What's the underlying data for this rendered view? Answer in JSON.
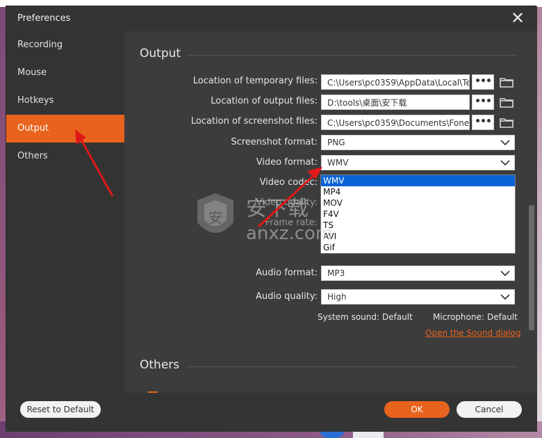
{
  "window": {
    "title": "Preferences"
  },
  "sidebar": {
    "items": [
      {
        "label": "Recording",
        "active": false
      },
      {
        "label": "Mouse",
        "active": false
      },
      {
        "label": "Hotkeys",
        "active": false
      },
      {
        "label": "Output",
        "active": true
      },
      {
        "label": "Others",
        "active": false
      }
    ]
  },
  "output": {
    "heading": "Output",
    "temp_files": {
      "label": "Location of temporary files:",
      "value": "C:\\Users\\pc0359\\AppData\\Local\\Te"
    },
    "output_files": {
      "label": "Location of output files:",
      "value": "D:\\tools\\桌面\\安下载"
    },
    "screenshot_files": {
      "label": "Location of screenshot files:",
      "value": "C:\\Users\\pc0359\\Documents\\FoneI"
    },
    "screenshot_format": {
      "label": "Screenshot format:",
      "value": "PNG"
    },
    "video_format": {
      "label": "Video format:",
      "value": "WMV",
      "options": [
        "WMV",
        "MP4",
        "MOV",
        "F4V",
        "TS",
        "AVI",
        "Gif"
      ],
      "selected_index": 0
    },
    "video_codec": {
      "label": "Video codec:"
    },
    "video_quality": {
      "label": "Video quality:"
    },
    "frame_rate": {
      "label": "Frame rate:"
    },
    "audio_format": {
      "label": "Audio format:",
      "value": "MP3"
    },
    "audio_quality": {
      "label": "Audio quality:",
      "value": "High"
    },
    "system_sound": {
      "label": "System sound:",
      "value": "Default"
    },
    "microphone": {
      "label": "Microphone:",
      "value": "Default"
    },
    "sound_dialog_link": "Open the Sound dialog"
  },
  "others": {
    "heading": "Others"
  },
  "footer": {
    "reset_label": "Reset to Default",
    "ok_label": "OK",
    "cancel_label": "Cancel"
  },
  "watermark": {
    "text_cn": "安下载",
    "text_en": "anxz.com"
  },
  "colors": {
    "accent": "#e8631e",
    "annotation": "#e01818",
    "selection": "#0a64d6"
  }
}
